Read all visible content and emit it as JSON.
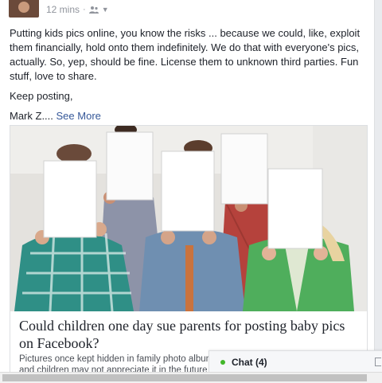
{
  "post": {
    "time": "12 mins",
    "text_lines": [
      "Putting kids pics online, you know the risks ... because we could, like, exploit them financially, hold onto them indefinitely. We do that with everyone's pics, actually. So, yep, should be fine. License them to unknown third parties. Fun stuff, love to share.",
      "Keep posting,"
    ],
    "signature": "Mark Z....",
    "see_more": "See More"
  },
  "link": {
    "headline": "Could children one day sue parents for posting baby pics on Facebook?",
    "description": "Pictures once kept hidden in family photo albums and children may not appreciate it in the future"
  },
  "chat": {
    "label": "Chat (4)"
  },
  "icons": {
    "privacy": "friends-icon",
    "caret": "chevron-down-icon",
    "online": "online-dot-icon"
  },
  "colors": {
    "link": "#365899",
    "meta": "#90949c",
    "online": "#42b72a"
  }
}
